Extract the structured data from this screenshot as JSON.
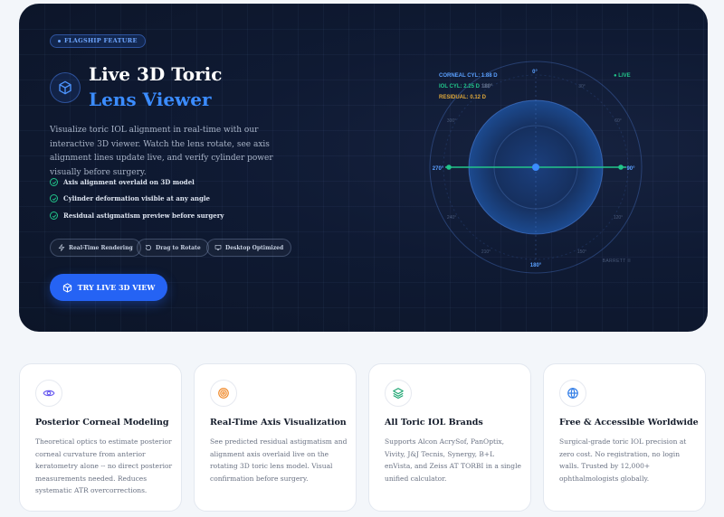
{
  "hero": {
    "badge": "FLAGSHIP FEATURE",
    "title_line1": "Live 3D Toric",
    "title_line2": "Lens Viewer",
    "description": "Visualize toric IOL alignment in real-time with our interactive 3D viewer. Watch the lens rotate, see axis alignment lines update live, and verify cylinder power visually before surgery.",
    "features": [
      "Axis alignment overlaid on 3D model",
      "Cylinder deformation visible at any angle",
      "Residual astigmatism preview before surgery"
    ],
    "chips": [
      "Real-Time Rendering",
      "Drag to Rotate",
      "Desktop Optimized"
    ],
    "cta": "TRY LIVE 3D VIEW"
  },
  "viewer": {
    "readouts": [
      {
        "label": "CORNEAL CYL: 1.88 D",
        "color": "#5aa0ff"
      },
      {
        "label": "IOL CYL: 2.25 D",
        "color": "#22c58a",
        "extra": "180°"
      },
      {
        "label": "RESIDUAL: 0.12 D",
        "color": "#e0a93b"
      }
    ],
    "live": "● LIVE",
    "degree_labels": {
      "d0": "0°",
      "d90": "90°",
      "d180": "180°",
      "d270": "270°",
      "d30": "30°",
      "d60": "60°",
      "d120": "120°",
      "d150": "150°",
      "d210": "210°",
      "d240": "240°",
      "d300": "300°",
      "d330": "330°"
    },
    "watermark": "BARRETT II",
    "accent": "#3b8cff",
    "axis_color": "#22c58a"
  },
  "cards": [
    {
      "icon": "eye-icon",
      "title": "Posterior Corneal Modeling",
      "body": "Theoretical optics to estimate posterior corneal curvature from anterior keratometry alone -- no direct posterior measurements needed. Reduces systematic ATR overcorrections."
    },
    {
      "icon": "target-icon",
      "title": "Real-Time Axis Visualization",
      "body": "See predicted residual astigmatism and alignment axis overlaid live on the rotating 3D toric lens model. Visual confirmation before surgery."
    },
    {
      "icon": "layers-icon",
      "title": "All Toric IOL Brands",
      "body": "Supports Alcon AcrySof, PanOptix, Vivity, J&J Tecnis, Synergy, B+L enVista, and Zeiss AT TORBI in a single unified calculator."
    },
    {
      "icon": "globe-icon",
      "title": "Free & Accessible Worldwide",
      "body": "Surgical-grade toric IOL precision at zero cost. No registration, no login walls. Trusted by 12,000+ ophthalmologists globally."
    }
  ]
}
